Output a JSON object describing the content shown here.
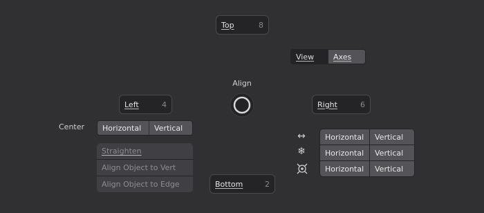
{
  "pie": {
    "title": "Align",
    "top": {
      "label": "Top",
      "key": "8"
    },
    "left": {
      "label": "Left",
      "key": "4"
    },
    "right": {
      "label": "Right",
      "key": "6"
    },
    "bottom": {
      "label": "Bottom",
      "key": "2"
    }
  },
  "view_axes": {
    "view_label": "View",
    "axes_label": "Axes"
  },
  "center": {
    "label": "Center",
    "horizontal": "Horizontal",
    "vertical": "Vertical"
  },
  "straighten": {
    "items": [
      "Straighten",
      "Align Object to Vert",
      "Align Object to Edge"
    ]
  },
  "axis_rows": [
    {
      "icon": "horizontal-arrows-icon",
      "horizontal": "Horizontal",
      "vertical": "Vertical"
    },
    {
      "icon": "snowflake-icon",
      "horizontal": "Horizontal",
      "vertical": "Vertical"
    },
    {
      "icon": "pivot-point-icon",
      "horizontal": "Horizontal",
      "vertical": "Vertical"
    }
  ],
  "colors": {
    "background": "#303033",
    "button_dark": "#242427",
    "button_mid": "#545458",
    "disabled_text": "#8e8e92"
  }
}
